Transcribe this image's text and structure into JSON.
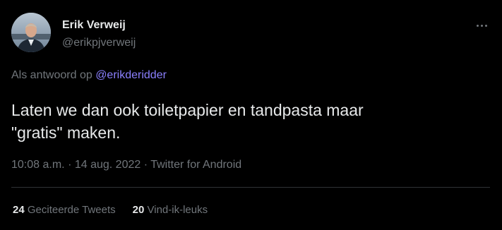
{
  "author": {
    "name": "Erik Verweij",
    "handle": "@erikpjverweij"
  },
  "reply": {
    "prefix": "Als antwoord op",
    "mention": "@erikderidder"
  },
  "tweet": {
    "text": "Laten we dan ook toiletpapier en tandpasta maar\n\"gratis\" maken."
  },
  "meta": {
    "time": "10:08 a.m.",
    "separator": "·",
    "date": "14 aug. 2022",
    "source": "Twitter for Android"
  },
  "stats": {
    "quote_count": "24",
    "quote_label": "Geciteerde Tweets",
    "like_count": "20",
    "like_label": "Vind-ik-leuks"
  },
  "colors": {
    "background": "#000000",
    "text": "#e7e9ea",
    "secondary": "#71767b",
    "mention": "#8b80ff",
    "divider": "#2f3336"
  },
  "icons": {
    "more": "more-horizontal-icon",
    "avatar": "profile-photo"
  }
}
